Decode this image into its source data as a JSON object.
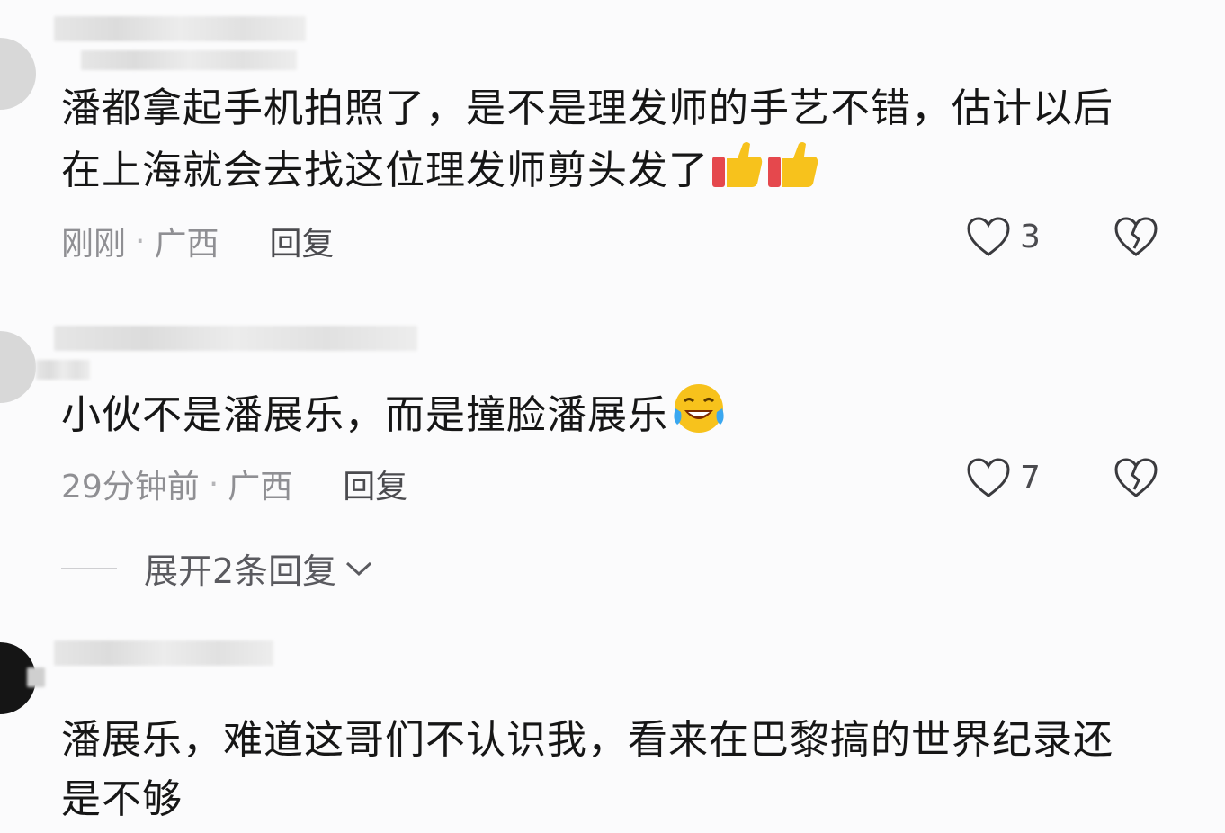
{
  "comments": [
    {
      "text": "潘都拿起手机拍照了，是不是理发师的手艺不错，估计以后在上海就会去找这位理发师剪头发了",
      "emoji": "thumbs-up-icon x2",
      "time": "刚刚",
      "dot": "·",
      "location": "广西",
      "reply_label": "回复",
      "likes": "3"
    },
    {
      "text": "小伙不是潘展乐，而是撞脸潘展乐",
      "emoji": "laughing-crying-icon",
      "time": "29分钟前",
      "dot": "·",
      "location": "广西",
      "reply_label": "回复",
      "likes": "7",
      "expand_label": "展开2条回复"
    },
    {
      "text": "潘展乐，难道这哥们不认识我，看来在巴黎搞的世界纪录还是不够"
    }
  ],
  "colors": {
    "heart": "#3a3a3e",
    "meta": "#8f8f93",
    "emoji_yellow": "#f7c21c",
    "emoji_red": "#e5484d"
  }
}
